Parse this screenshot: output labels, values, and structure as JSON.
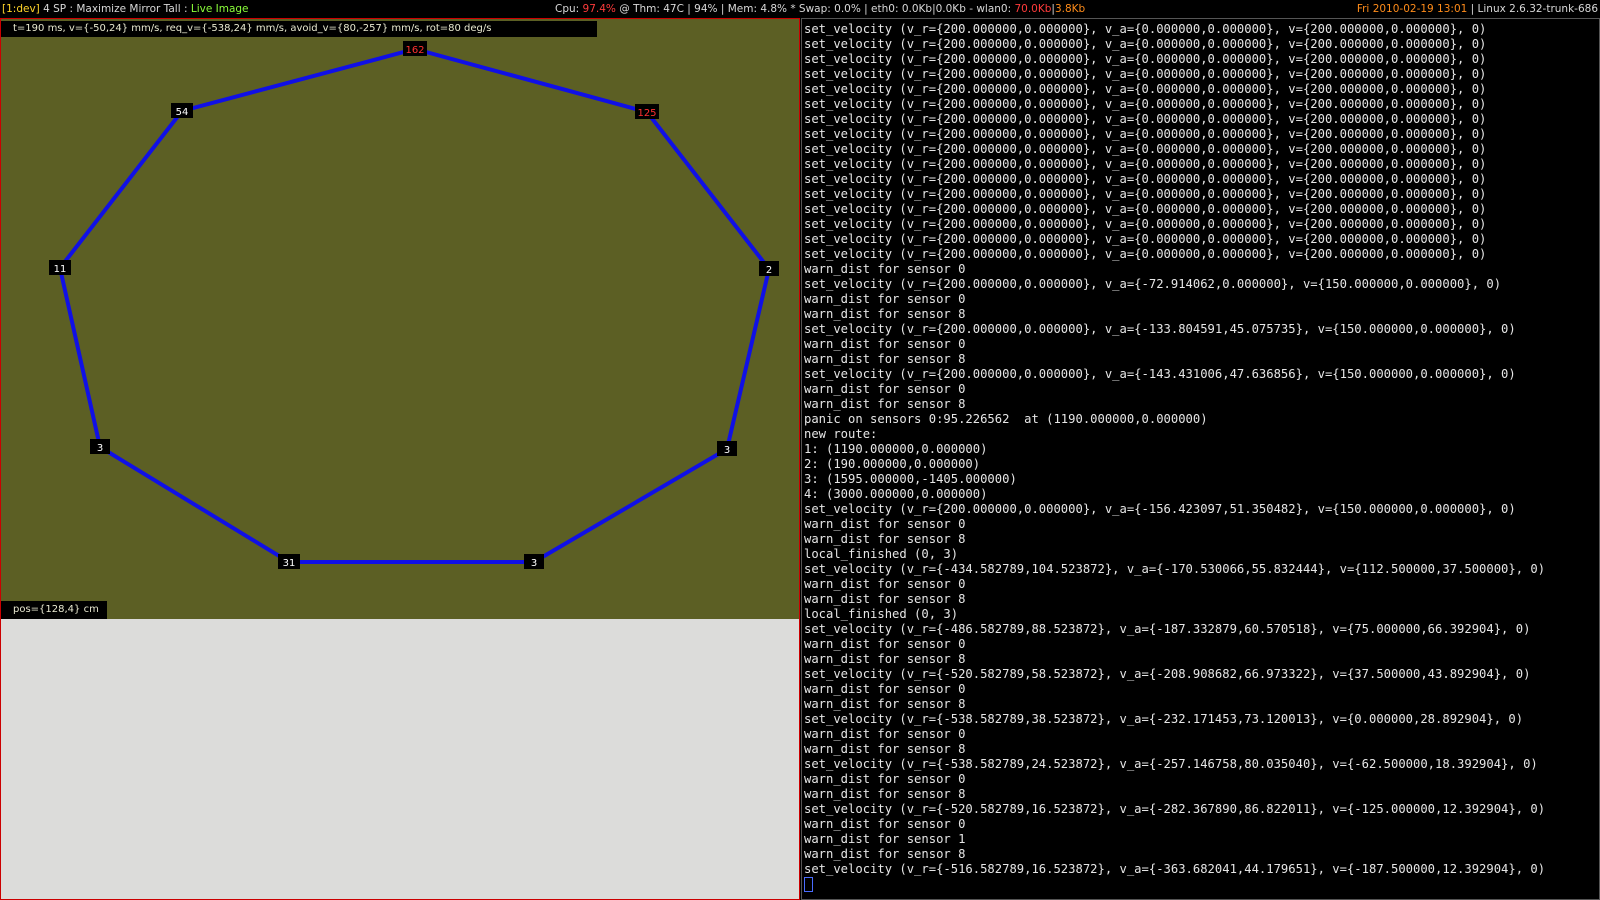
{
  "statusbar": {
    "workspace": "[1:dev]",
    "title_prefix": "4 SP : Maximize Mirror Tall : ",
    "title_live": "Live Image",
    "cpu_label": "Cpu: ",
    "cpu_value": "97.4%",
    "sys_info": " @ Thm: 47C | 94% | Mem: 4.8% * Swap: 0.0% | eth0: 0.0Kb|0.0Kb - wlan0: ",
    "wlan_down": "70.0Kb",
    "wlan_sep": "|",
    "wlan_up": "3.8Kb",
    "datetime": "Fri 2010-02-19 13:01",
    "kernel": " | Linux 2.6.32-trunk-686"
  },
  "camera": {
    "header": "t=190 ms, v={-50,24} mm/s, req_v={-538,24} mm/s, avoid_v={80,-257} mm/s, rot=80 deg/s",
    "pos": "pos={128,4} cm",
    "sensors": [
      {
        "label": "162",
        "warn": true
      },
      {
        "label": "125",
        "warn": true
      },
      {
        "label": "2",
        "warn": false
      },
      {
        "label": "3",
        "warn": false
      },
      {
        "label": "3",
        "warn": false
      },
      {
        "label": "31",
        "warn": false
      },
      {
        "label": "3",
        "warn": false
      },
      {
        "label": "11",
        "warn": false
      },
      {
        "label": "54",
        "warn": false
      }
    ],
    "colors": {
      "polygon": "#1010e6",
      "background": "#5c5f24",
      "warn_text": "#ff3030",
      "normal_text": "#ffffff"
    }
  },
  "terminal": {
    "lines": [
      "set_velocity (v_r={200.000000,0.000000}, v_a={0.000000,0.000000}, v={200.000000,0.000000}, 0)",
      "set_velocity (v_r={200.000000,0.000000}, v_a={0.000000,0.000000}, v={200.000000,0.000000}, 0)",
      "set_velocity (v_r={200.000000,0.000000}, v_a={0.000000,0.000000}, v={200.000000,0.000000}, 0)",
      "set_velocity (v_r={200.000000,0.000000}, v_a={0.000000,0.000000}, v={200.000000,0.000000}, 0)",
      "set_velocity (v_r={200.000000,0.000000}, v_a={0.000000,0.000000}, v={200.000000,0.000000}, 0)",
      "set_velocity (v_r={200.000000,0.000000}, v_a={0.000000,0.000000}, v={200.000000,0.000000}, 0)",
      "set_velocity (v_r={200.000000,0.000000}, v_a={0.000000,0.000000}, v={200.000000,0.000000}, 0)",
      "set_velocity (v_r={200.000000,0.000000}, v_a={0.000000,0.000000}, v={200.000000,0.000000}, 0)",
      "set_velocity (v_r={200.000000,0.000000}, v_a={0.000000,0.000000}, v={200.000000,0.000000}, 0)",
      "set_velocity (v_r={200.000000,0.000000}, v_a={0.000000,0.000000}, v={200.000000,0.000000}, 0)",
      "set_velocity (v_r={200.000000,0.000000}, v_a={0.000000,0.000000}, v={200.000000,0.000000}, 0)",
      "set_velocity (v_r={200.000000,0.000000}, v_a={0.000000,0.000000}, v={200.000000,0.000000}, 0)",
      "set_velocity (v_r={200.000000,0.000000}, v_a={0.000000,0.000000}, v={200.000000,0.000000}, 0)",
      "set_velocity (v_r={200.000000,0.000000}, v_a={0.000000,0.000000}, v={200.000000,0.000000}, 0)",
      "set_velocity (v_r={200.000000,0.000000}, v_a={0.000000,0.000000}, v={200.000000,0.000000}, 0)",
      "set_velocity (v_r={200.000000,0.000000}, v_a={0.000000,0.000000}, v={200.000000,0.000000}, 0)",
      "warn_dist for sensor 0",
      "set_velocity (v_r={200.000000,0.000000}, v_a={-72.914062,0.000000}, v={150.000000,0.000000}, 0)",
      "warn_dist for sensor 0",
      "warn_dist for sensor 8",
      "set_velocity (v_r={200.000000,0.000000}, v_a={-133.804591,45.075735}, v={150.000000,0.000000}, 0)",
      "warn_dist for sensor 0",
      "warn_dist for sensor 8",
      "set_velocity (v_r={200.000000,0.000000}, v_a={-143.431006,47.636856}, v={150.000000,0.000000}, 0)",
      "warn_dist for sensor 0",
      "warn_dist for sensor 8",
      "panic on sensors 0:95.226562  at (1190.000000,0.000000)",
      "new route:",
      "1: (1190.000000,0.000000)",
      "2: (190.000000,0.000000)",
      "3: (1595.000000,-1405.000000)",
      "4: (3000.000000,0.000000)",
      "set_velocity (v_r={200.000000,0.000000}, v_a={-156.423097,51.350482}, v={150.000000,0.000000}, 0)",
      "warn_dist for sensor 0",
      "warn_dist for sensor 8",
      "local_finished (0, 3)",
      "set_velocity (v_r={-434.582789,104.523872}, v_a={-170.530066,55.832444}, v={112.500000,37.500000}, 0)",
      "warn_dist for sensor 0",
      "warn_dist for sensor 8",
      "local_finished (0, 3)",
      "set_velocity (v_r={-486.582789,88.523872}, v_a={-187.332879,60.570518}, v={75.000000,66.392904}, 0)",
      "warn_dist for sensor 0",
      "warn_dist for sensor 8",
      "set_velocity (v_r={-520.582789,58.523872}, v_a={-208.908682,66.973322}, v={37.500000,43.892904}, 0)",
      "warn_dist for sensor 0",
      "warn_dist for sensor 8",
      "set_velocity (v_r={-538.582789,38.523872}, v_a={-232.171453,73.120013}, v={0.000000,28.892904}, 0)",
      "warn_dist for sensor 0",
      "warn_dist for sensor 8",
      "set_velocity (v_r={-538.582789,24.523872}, v_a={-257.146758,80.035040}, v={-62.500000,18.392904}, 0)",
      "warn_dist for sensor 0",
      "warn_dist for sensor 8",
      "set_velocity (v_r={-520.582789,16.523872}, v_a={-282.367890,86.822011}, v={-125.000000,12.392904}, 0)",
      "warn_dist for sensor 0",
      "warn_dist for sensor 1",
      "warn_dist for sensor 8",
      "set_velocity (v_r={-516.582789,16.523872}, v_a={-363.682041,44.179651}, v={-187.500000,12.392904}, 0)"
    ]
  }
}
